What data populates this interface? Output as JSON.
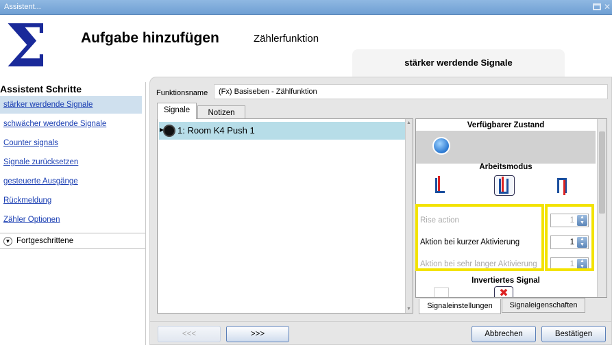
{
  "window": {
    "title": "Assistent..."
  },
  "header": {
    "title": "Aufgabe hinzufügen",
    "subtitle": "Zählerfunktion",
    "current_step": "stärker werdende Signale"
  },
  "sidebar": {
    "heading": "Assistent Schritte",
    "items": [
      {
        "label": "stärker werdende Signale",
        "active": true
      },
      {
        "label": "schwächer werdende Signale"
      },
      {
        "label": "Counter signals"
      },
      {
        "label": "Signale zurücksetzen"
      },
      {
        "label": "gesteuerte Ausgänge"
      },
      {
        "label": "Rückmeldung"
      },
      {
        "label": "Zähler Optionen"
      }
    ],
    "advanced_label": "Fortgeschrittene"
  },
  "function": {
    "label": "Funktionsname",
    "value": "(Fx) Basiseben - Zählfunktion"
  },
  "tabs": [
    "Signale",
    "Notizen"
  ],
  "signals": [
    {
      "label": "1: Room K4 Push 1"
    }
  ],
  "properties": {
    "available_state": "Verfügbarer Zustand",
    "work_mode": "Arbeitsmodus",
    "fields": [
      {
        "label": "Rise action",
        "value": "1",
        "enabled": false
      },
      {
        "label": "Aktion bei kurzer Aktivierung",
        "value": "1",
        "enabled": true
      },
      {
        "label": "Aktion bei sehr langer Aktivierung",
        "value": "1",
        "enabled": false
      }
    ],
    "inverted_signal": "Invertiertes Signal",
    "tabs": [
      "Signaleinstellungen",
      "Signaleigenschaften"
    ]
  },
  "buttons": {
    "prev": "<<<",
    "next": ">>>",
    "cancel": "Abbrechen",
    "confirm": "Bestätigen"
  },
  "colors": {
    "highlight": "#f3e300",
    "selected_row": "#b7dde8",
    "link": "#1b3fb3"
  }
}
